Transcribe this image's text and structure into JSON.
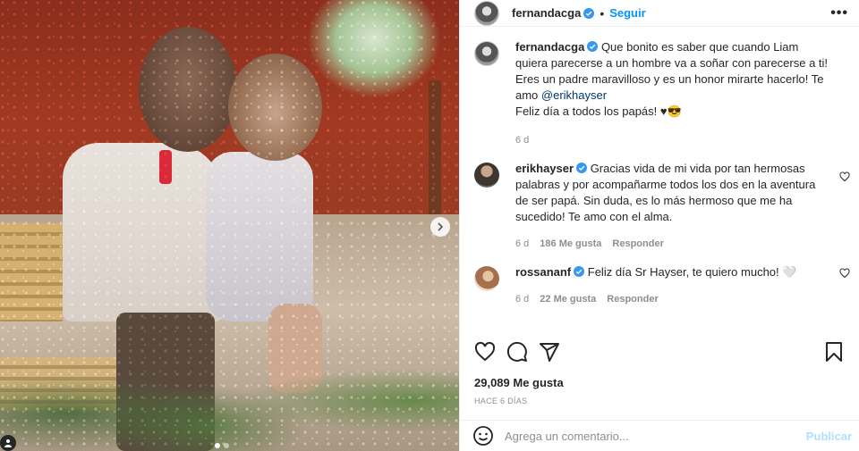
{
  "post": {
    "author": "fernandacga",
    "follow_label": "Seguir",
    "more_label": "•••",
    "caption": {
      "username": "fernandacga",
      "text_before_mention": "Que bonito es saber que cuando Liam quiera parecerse a un hombre va a soñar con parecerse a ti! Eres un padre maravilloso y es un honor mirarte hacerlo! Te amo ",
      "mention": "@erikhayser",
      "line2": "Feliz día a todos los papás! ♥😎",
      "age": "6 d"
    },
    "comments": [
      {
        "username": "erikhayser",
        "text": "Gracias vida de mi vida por tan hermosas palabras y por acompañarme todos los dos en la aventura de ser papá. Sin duda, es lo más hermoso que me ha sucedido! Te amo con el alma.",
        "age": "6 d",
        "likes": "186 Me gusta",
        "reply": "Responder"
      },
      {
        "username": "rossananf",
        "text": "Feliz día Sr Hayser, te quiero mucho! 🤍",
        "age": "6 d",
        "likes": "22 Me gusta",
        "reply": "Responder"
      }
    ],
    "likes_count": "29,089 Me gusta",
    "posted_date": "HACE 6 DÍAS",
    "add_comment_placeholder": "Agrega un comentario...",
    "publish_label": "Publicar",
    "carousel": {
      "slides": 2,
      "active": 1
    }
  },
  "colors": {
    "link": "#0095f6",
    "mention": "#00376b",
    "muted": "#8e8e8e",
    "verified": "#3897f0"
  }
}
